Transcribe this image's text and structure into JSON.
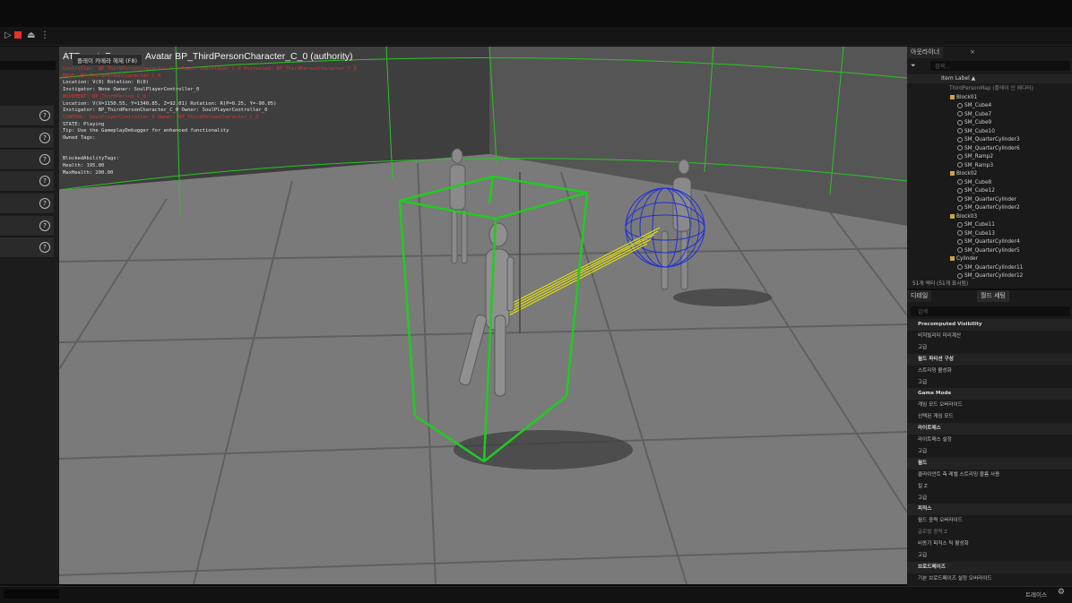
{
  "toolbar": {
    "play_icon": "play-icon",
    "stop_icon": "stop-icon",
    "eject_icon": "eject-icon",
    "more_icon": "more-icon"
  },
  "viewport": {
    "title": "ATTempt: Possess: Avatar BP_ThirdPersonCharacter_C_0 (authority)",
    "exit_label": "플레이 카메라 해제 (F8)",
    "debug_lines": [
      {
        "text": "Controller: BP_ThirdPersonCharacter_C_0 Pawn: SoulPlayer_C_0 Possessed: BP_ThirdPersonCharacter_C_0",
        "color": "red"
      },
      {
        "text": "BASE: BP_ThirdPersonCharacter_C_0",
        "color": "red"
      },
      {
        "text": "Location: V(0) Rotation: R(0)",
        "color": "white"
      },
      {
        "text": "Instigator: None Owner: SoulPlayerController_0",
        "color": "white"
      },
      {
        "text": "MOVEMENT: BP_ThirdPerson_C_0",
        "color": "red"
      },
      {
        "text": "Location: V(X=1150.55, Y=1340.85, Z=92.01) Rotation: R(P=0.25, Y=-90.05)",
        "color": "white"
      },
      {
        "text": "Instigator: BP_ThirdPersonCharacter_C_0 Owner: SoulPlayerController_0",
        "color": "white"
      },
      {
        "text": "CONTROL: SoulPlayerController_0 Owner: BP_ThirdPersonCharacter_C_0",
        "color": "red"
      },
      {
        "text": "STATE: Playing",
        "color": "white"
      },
      {
        "text": "Tip: Use the GameplayDebugger for enhanced functionality",
        "color": "white"
      },
      {
        "text": "Owned Tags:",
        "color": "white"
      },
      {
        "text": "",
        "color": "white"
      },
      {
        "text": "",
        "color": "white"
      },
      {
        "text": "BlockedAbilityTags:",
        "color": "white"
      },
      {
        "text": "Health: 195.00",
        "color": "white"
      },
      {
        "text": "MaxHealth: 200.00",
        "color": "white"
      }
    ]
  },
  "outliner": {
    "tab_label": "아웃라이너",
    "search_placeholder": "검색...",
    "column_label": "Item Label ▲",
    "items": [
      {
        "label": "ThirdPersonMap (플레이 인 에디터)",
        "indent": 0,
        "type": "map"
      },
      {
        "label": "Block01",
        "indent": 1,
        "type": "folder"
      },
      {
        "label": "SM_Cube4",
        "indent": 2,
        "type": "mesh"
      },
      {
        "label": "SM_Cube7",
        "indent": 2,
        "type": "mesh"
      },
      {
        "label": "SM_Cube9",
        "indent": 2,
        "type": "mesh"
      },
      {
        "label": "SM_Cube10",
        "indent": 2,
        "type": "mesh"
      },
      {
        "label": "SM_QuarterCylinder3",
        "indent": 2,
        "type": "mesh"
      },
      {
        "label": "SM_QuarterCylinder6",
        "indent": 2,
        "type": "mesh"
      },
      {
        "label": "SM_Ramp2",
        "indent": 2,
        "type": "mesh"
      },
      {
        "label": "SM_Ramp3",
        "indent": 2,
        "type": "mesh"
      },
      {
        "label": "Block02",
        "indent": 1,
        "type": "folder"
      },
      {
        "label": "SM_Cube8",
        "indent": 2,
        "type": "mesh"
      },
      {
        "label": "SM_Cube12",
        "indent": 2,
        "type": "mesh"
      },
      {
        "label": "SM_QuarterCylinder",
        "indent": 2,
        "type": "mesh"
      },
      {
        "label": "SM_QuarterCylinder2",
        "indent": 2,
        "type": "mesh"
      },
      {
        "label": "Block03",
        "indent": 1,
        "type": "folder"
      },
      {
        "label": "SM_Cube11",
        "indent": 2,
        "type": "mesh"
      },
      {
        "label": "SM_Cube13",
        "indent": 2,
        "type": "mesh"
      },
      {
        "label": "SM_QuarterCylinder4",
        "indent": 2,
        "type": "mesh"
      },
      {
        "label": "SM_QuarterCylinder5",
        "indent": 2,
        "type": "mesh"
      },
      {
        "label": "Cylinder",
        "indent": 1,
        "type": "folder"
      },
      {
        "label": "SM_QuarterCylinder11",
        "indent": 2,
        "type": "mesh"
      },
      {
        "label": "SM_QuarterCylinder12",
        "indent": 2,
        "type": "mesh"
      }
    ],
    "footer": "51개 액터 (51개 표시됨)"
  },
  "details": {
    "tab_details": "디테일",
    "tab_world": "월드 세팅",
    "search_placeholder": "검색",
    "rows": [
      {
        "label": "Precomputed Visibility",
        "kind": "header"
      },
      {
        "label": "비저빌리티 미리계산",
        "kind": "item"
      },
      {
        "label": "고급",
        "kind": "sub"
      },
      {
        "label": "월드 파티션 구성",
        "kind": "header"
      },
      {
        "label": "스트리밍 활성화",
        "kind": "item"
      },
      {
        "label": "고급",
        "kind": "sub"
      },
      {
        "label": "Game Mode",
        "kind": "header"
      },
      {
        "label": "게임 모드 오버라이드",
        "kind": "item"
      },
      {
        "label": "선택된 게임 모드",
        "kind": "sub"
      },
      {
        "label": "라이트매스",
        "kind": "header"
      },
      {
        "label": "라이트매스 설정",
        "kind": "sub"
      },
      {
        "label": "고급",
        "kind": "sub"
      },
      {
        "label": "월드",
        "kind": "header"
      },
      {
        "label": "클라이언트 측 레벨 스트리밍 볼륨 사용",
        "kind": "item"
      },
      {
        "label": "킬 Z",
        "kind": "item"
      },
      {
        "label": "고급",
        "kind": "sub"
      },
      {
        "label": "피직스",
        "kind": "header"
      },
      {
        "label": "월드 중력 오버라이드",
        "kind": "item"
      },
      {
        "label": "글로벌 중력 Z",
        "kind": "dim"
      },
      {
        "label": "비동기 피직스 틱 활성화",
        "kind": "item"
      },
      {
        "label": "고급",
        "kind": "sub"
      },
      {
        "label": "브로드페이즈",
        "kind": "header"
      },
      {
        "label": "기본 브로드페이즈 설정 오버라이드",
        "kind": "item"
      }
    ]
  },
  "status": {
    "trace_label": "트레이스"
  }
}
